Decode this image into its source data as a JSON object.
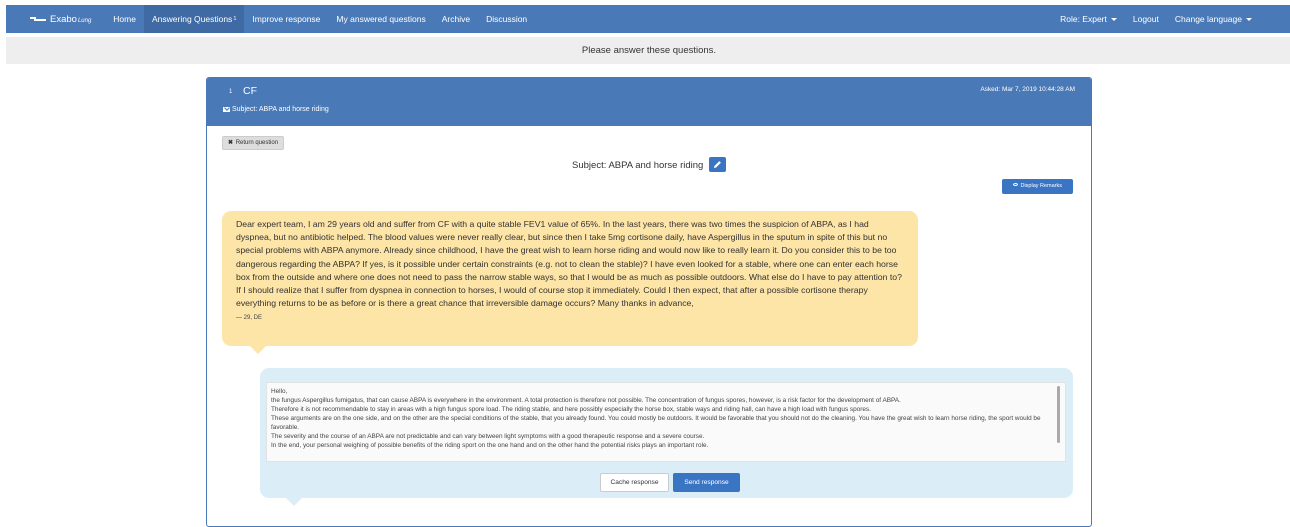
{
  "navbar": {
    "brand": "Exabo",
    "brand_sub": "Lung",
    "items": [
      {
        "label": "Home"
      },
      {
        "label": "Answering Questions",
        "badge": "1"
      },
      {
        "label": "Improve response"
      },
      {
        "label": "My answered questions"
      },
      {
        "label": "Archive"
      },
      {
        "label": "Discussion"
      }
    ],
    "role": "Role: Expert",
    "logout": "Logout",
    "language": "Change language"
  },
  "banner": "Please answer these questions.",
  "question": {
    "number": "1",
    "title": "CF",
    "asked": "Asked: Mar 7, 2019 10:44:28 AM",
    "subject_line": "Subject: ABPA and horse riding",
    "return_label": "Return question",
    "subject": "Subject: ABPA and horse riding",
    "remarks_label": "Display Remarks",
    "text": "Dear expert team, I am 29 years old and suffer from CF with a quite stable FEV1 value of 65%. In the last years, there was two times the suspicion of ABPA, as I had dyspnea, but no antibiotic helped. The blood values were never really clear, but since then I take 5mg cortisone daily, have Aspergillus in the sputum in spite of this but no special problems with ABPA anymore. Already since childhood, I have the great wish to learn horse riding and would now like to really learn it. Do you consider this to be too dangerous regarding the ABPA? If yes, is it possible under certain constraints (e.g. not to clean the stable)? I have even looked for a stable, where one can enter each horse box from the outside and where one does not need to pass the narrow stable ways, so that I would be as much as possible outdoors. What else do I have to pay attention to? If I should realize that I suffer from dyspnea in connection to horses, I would of course stop it immediately. Could I then expect, that after a possible cortisone therapy everything returns to be as before or is there a great chance that irreversible damage occurs? Many thanks in advance,",
    "author": "— 29, DE"
  },
  "answer": {
    "text": "Hello,\nthe fungus Aspergillus fumigatus, that can cause ABPA is everywhere in the environment. A total protection is therefore not possible. The concentration of fungus spores, however, is a risk factor for the development of ABPA.\nTherefore it is not recommendable to stay in areas with a high fungus spore load. The riding stable, and here possibly especially the horse box, stable ways and riding hall, can have a high load with fungus spores.\nThese arguments are on the one side, and on the other are the special conditions of the stable, that you already found. You could mostly be outdoors. It would be favorable that you should not do the cleaning. You have the great wish to learn horse riding, the sport would be favorable.\nThe severity and the course of an ABPA are not predictable and can vary between light symptoms with a good therapeutic response and a severe course.\nIn the end, your personal weighing of possible benefits of the riding sport on the one hand and on the other hand the potential risks plays an important role.",
    "cache_label": "Cache response",
    "send_label": "Send response"
  }
}
